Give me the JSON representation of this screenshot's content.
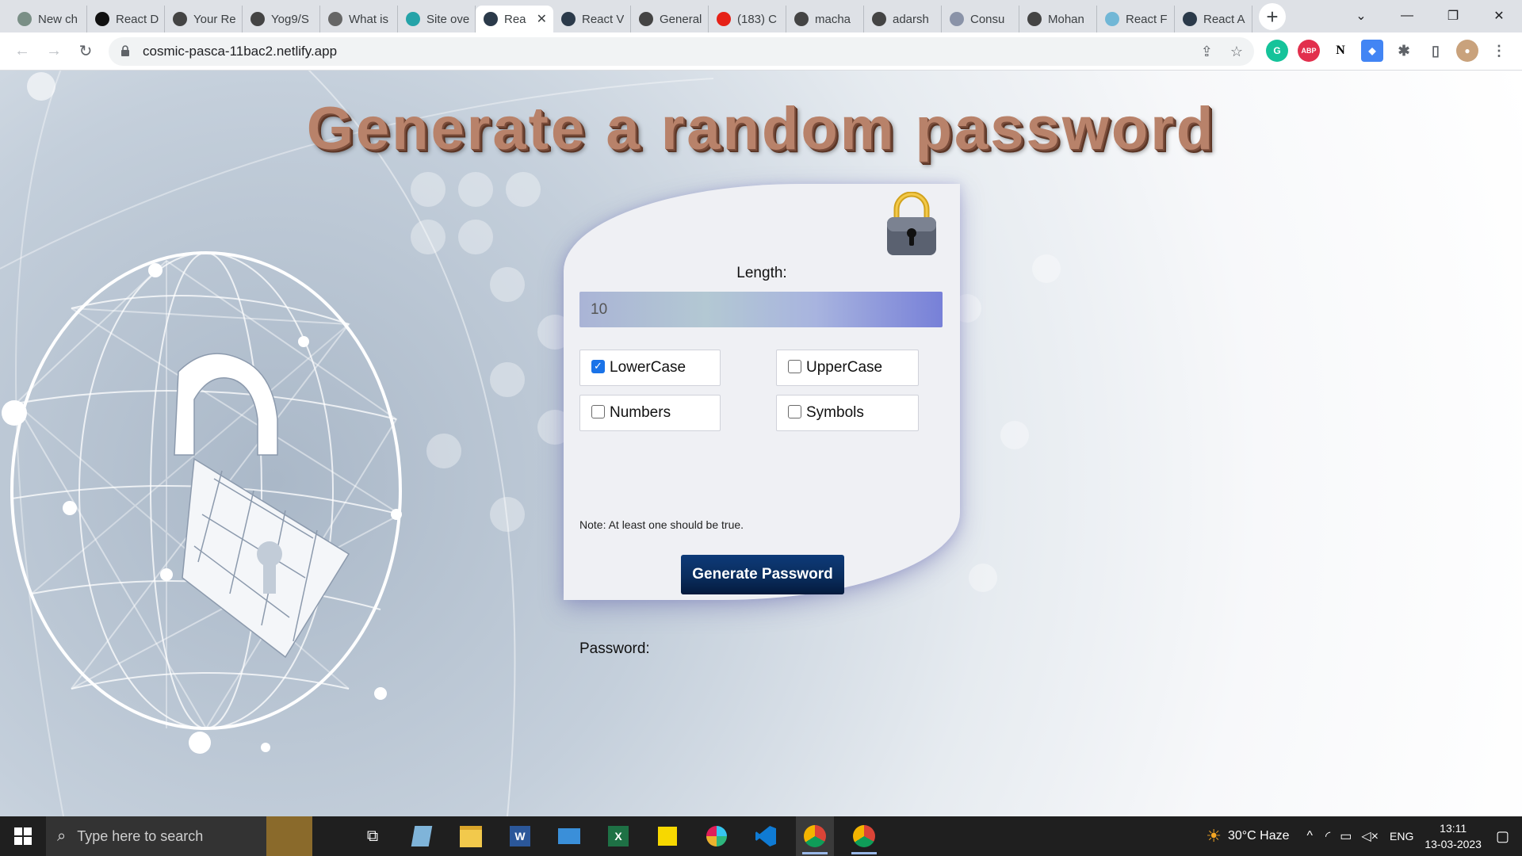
{
  "browser": {
    "tabs": [
      {
        "label": "New ch",
        "icon": "openai-icon",
        "color": "#7a8f86"
      },
      {
        "label": "React D",
        "icon": "react-doc-icon",
        "color": "#111111"
      },
      {
        "label": "Your Re",
        "icon": "github-icon",
        "color": "#444444"
      },
      {
        "label": "Yog9/S",
        "icon": "github-icon",
        "color": "#444444"
      },
      {
        "label": "What is",
        "icon": "page-icon",
        "color": "#666666"
      },
      {
        "label": "Site ove",
        "icon": "netlify-icon",
        "color": "#25a3a8"
      },
      {
        "label": "Rea",
        "icon": "react-icon",
        "color": "#2b3a4a",
        "active": true
      },
      {
        "label": "React V",
        "icon": "react-icon",
        "color": "#2b3a4a"
      },
      {
        "label": "General",
        "icon": "github-icon",
        "color": "#444444"
      },
      {
        "label": "(183) C",
        "icon": "youtube-icon",
        "color": "#e62117"
      },
      {
        "label": "macha",
        "icon": "github-icon",
        "color": "#444444"
      },
      {
        "label": "adarsh",
        "icon": "github-icon",
        "color": "#444444"
      },
      {
        "label": "Consu",
        "icon": "globe-icon",
        "color": "#8a93a8"
      },
      {
        "label": "Mohan",
        "icon": "github-icon",
        "color": "#444444"
      },
      {
        "label": "React F",
        "icon": "react-icon",
        "color": "#71b7d6"
      },
      {
        "label": "React A",
        "icon": "react-icon",
        "color": "#2b3a4a"
      }
    ],
    "url": "cosmic-pasca-11bac2.netlify.app",
    "close_glyph": "✕",
    "newtab_glyph": "+"
  },
  "app": {
    "title": "Generate a random password",
    "length_label": "Length:",
    "length_value": "10",
    "options": [
      {
        "label": "LowerCase",
        "checked": true
      },
      {
        "label": "UpperCase",
        "checked": false
      },
      {
        "label": "Numbers",
        "checked": false
      },
      {
        "label": "Symbols",
        "checked": false
      }
    ],
    "note": "Note: At least one should be true.",
    "generate_label": "Generate Password",
    "password_label": "Password:"
  },
  "taskbar": {
    "search_placeholder": "Type here to search",
    "weather": "30°C  Haze",
    "language": "ENG",
    "time": "13:11",
    "date": "13-03-2023"
  },
  "colors": {
    "title": "#b8826a",
    "button": "#0a2d5e",
    "checkbox_on": "#1a73e8"
  }
}
